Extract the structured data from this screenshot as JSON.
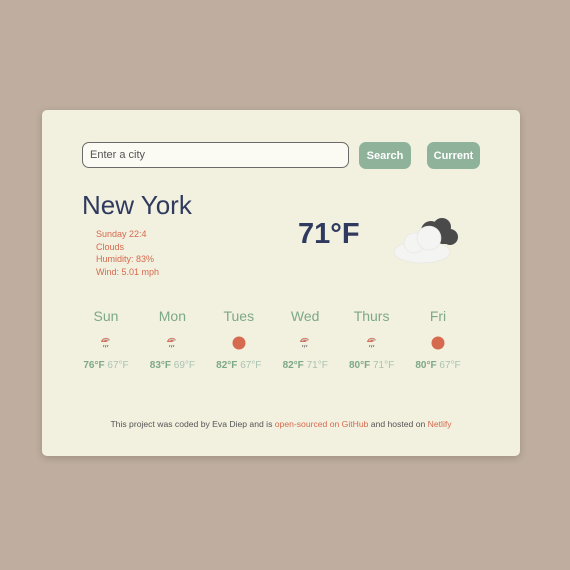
{
  "search": {
    "placeholder": "Enter a city",
    "value": "",
    "search_label": "Search",
    "current_label": "Current"
  },
  "current": {
    "city": "New York",
    "datetime": "Sunday 22:4",
    "description": "Clouds",
    "humidity": "Humidity: 83%",
    "wind": "Wind: 5.01 mph",
    "temperature": "71°F",
    "icon": "cloudy-icon"
  },
  "forecast": [
    {
      "day": "Sun",
      "max": "76°F",
      "min": "67°F",
      "icon": "rain-icon"
    },
    {
      "day": "Mon",
      "max": "83°F",
      "min": "69°F",
      "icon": "rain-icon"
    },
    {
      "day": "Tues",
      "max": "82°F",
      "min": "67°F",
      "icon": "sun-icon"
    },
    {
      "day": "Wed",
      "max": "82°F",
      "min": "71°F",
      "icon": "rain-icon"
    },
    {
      "day": "Thurs",
      "max": "80°F",
      "min": "71°F",
      "icon": "rain-icon"
    },
    {
      "day": "Fri",
      "max": "80°F",
      "min": "67°F",
      "icon": "sun-icon"
    }
  ],
  "footer": {
    "text1": "This project was coded by Eva Diep and is ",
    "link1": "open-sourced on GitHub",
    "text2": " and hosted on ",
    "link2": "Netlify"
  },
  "colors": {
    "background": "#bfae9f",
    "card": "#f2f0df",
    "accent": "#8fb29b",
    "text_dark": "#2f3a5e",
    "highlight": "#d66a4e"
  }
}
